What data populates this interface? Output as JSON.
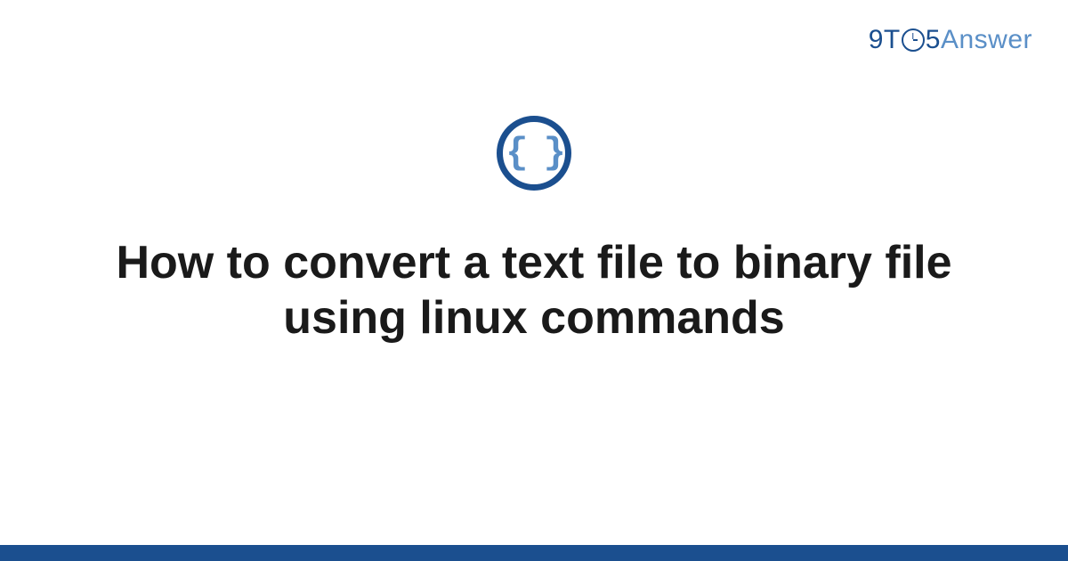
{
  "logo": {
    "part1": "9T",
    "part2": "5",
    "part3": "Answer"
  },
  "icon": {
    "name": "code-braces",
    "glyph": "{ }"
  },
  "title": "How to convert a text file to binary file using linux commands",
  "colors": {
    "primary": "#1b4f8f",
    "secondary": "#5a8fc7",
    "text": "#1a1a1a"
  }
}
